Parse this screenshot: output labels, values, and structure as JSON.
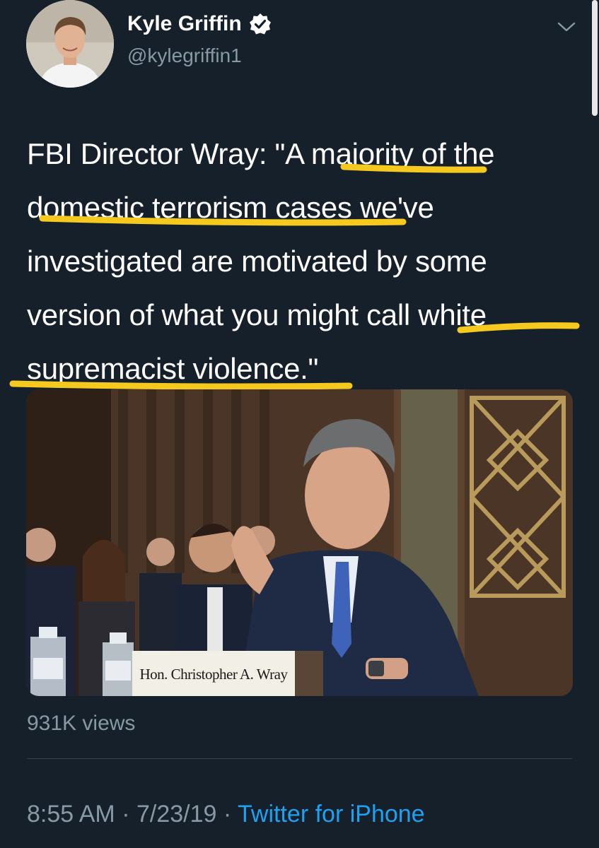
{
  "author": {
    "name": "Kyle Griffin",
    "handle": "@kylegriffin1",
    "verified": true
  },
  "tweet": {
    "lines": [
      "FBI Director Wray: \"A majority of the",
      "domestic terrorism cases we've",
      "investigated are motivated by some",
      "version of what you might call white",
      "supremacist violence.\""
    ]
  },
  "media": {
    "nameplate": "Hon. Christopher A. Wray"
  },
  "stats": {
    "views": "931K views"
  },
  "meta": {
    "time": "8:55 AM",
    "separator": " · ",
    "date": "7/23/19",
    "source": "Twitter for iPhone"
  },
  "colors": {
    "background": "#15202b",
    "text": "#ffffff",
    "secondary": "#8899a6",
    "link": "#1da1f2",
    "highlight": "#f5c91e",
    "verified": "#1da1f2"
  },
  "icons": {
    "verified": "verified-badge-icon",
    "menu": "chevron-down-icon"
  }
}
